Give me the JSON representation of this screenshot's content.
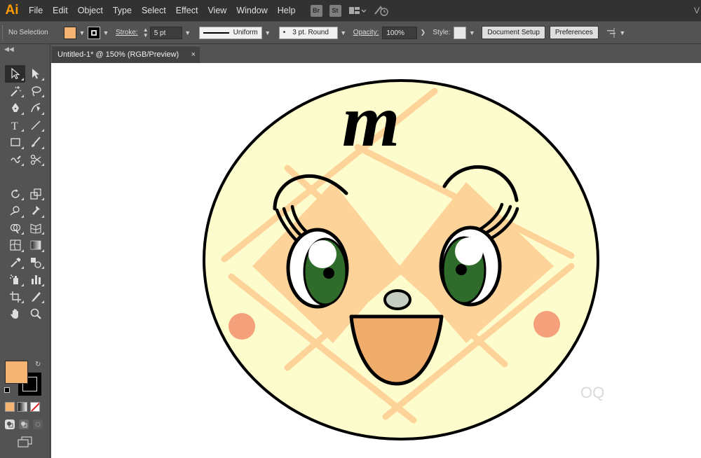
{
  "app": {
    "logo": "Ai",
    "menus": [
      "File",
      "Edit",
      "Object",
      "Type",
      "Select",
      "Effect",
      "View",
      "Window",
      "Help"
    ],
    "bridge_label": "Br",
    "stock_label": "St",
    "workspace_label": "V"
  },
  "control_bar": {
    "selection_status": "No Selection",
    "fill_color": "#f5b472",
    "stroke_label": "Stroke:",
    "stroke_weight": "5 pt",
    "profile": "Uniform",
    "brush": "3 pt. Round",
    "opacity_label": "Opacity:",
    "opacity_value": "100%",
    "style_label": "Style:",
    "document_setup_label": "Document Setup",
    "preferences_label": "Preferences"
  },
  "document": {
    "tab_title": "Untitled-1* @ 150% (RGB/Preview)",
    "close_glyph": "×"
  },
  "toolbar": {
    "fill_color": "#f5b472",
    "stroke_color": "#000000",
    "tools": [
      "selection-tool",
      "direct-selection-tool",
      "magic-wand-tool",
      "lasso-tool",
      "pen-tool",
      "curvature-tool",
      "type-tool",
      "line-segment-tool",
      "rectangle-tool",
      "paintbrush-tool",
      "shaper-tool",
      "scissors-tool",
      "rotate-tool",
      "scale-tool",
      "warp-tool",
      "puppet-warp-tool",
      "shape-builder-tool",
      "perspective-grid-tool",
      "mesh-tool",
      "gradient-tool",
      "eyedropper-tool",
      "blend-tool",
      "symbol-sprayer-tool",
      "column-graph-tool",
      "artboard-tool",
      "slice-tool",
      "hand-tool",
      "zoom-tool"
    ]
  },
  "artwork": {
    "logo_letter": "m",
    "face_color": "#fdfccd",
    "pattern_color": "#fdd39a",
    "cheek_color": "#f4a07a",
    "mouth_color": "#f0ac6b",
    "iris_color": "#2f6b2a",
    "nose_color": "#c6cec3",
    "watermark": "OQ"
  }
}
